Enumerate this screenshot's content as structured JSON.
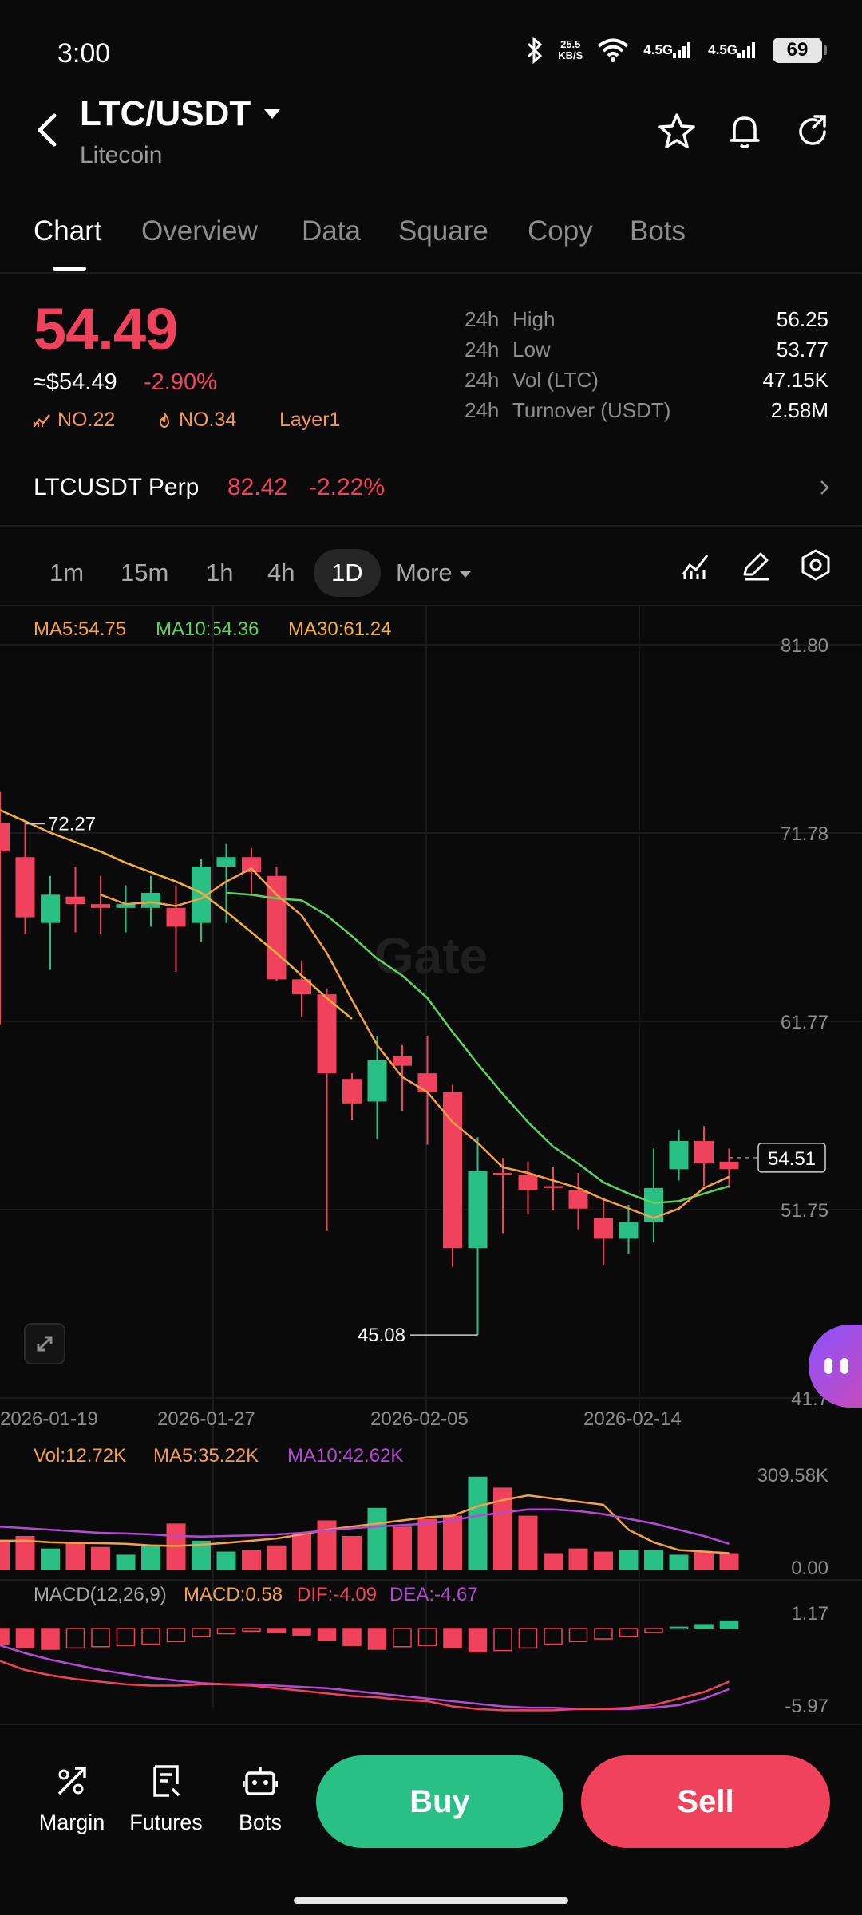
{
  "status": {
    "time": "3:00",
    "net_speed_top": "25.5",
    "net_speed_bottom": "KB/S",
    "net1": "4.5G",
    "net2": "4.5G",
    "battery": "69"
  },
  "header": {
    "pair": "LTC/USDT",
    "name": "Litecoin"
  },
  "tabs": [
    "Chart",
    "Overview",
    "Data",
    "Square",
    "Copy",
    "Bots"
  ],
  "price": {
    "last": "54.49",
    "usd": "≈$54.49",
    "change": "-2.90%",
    "rank1": "NO.22",
    "rank2": "NO.34",
    "category": "Layer1"
  },
  "stats": [
    {
      "period": "24h",
      "label": "High",
      "value": "56.25"
    },
    {
      "period": "24h",
      "label": "Low",
      "value": "53.77"
    },
    {
      "period": "24h",
      "label": "Vol (LTC)",
      "value": "47.15K"
    },
    {
      "period": "24h",
      "label": "Turnover (USDT)",
      "value": "2.58M"
    }
  ],
  "perp": {
    "name": "LTCUSDT Perp",
    "price": "82.42",
    "change": "-2.22%"
  },
  "timeframes": [
    "1m",
    "15m",
    "1h",
    "4h",
    "1D",
    "More"
  ],
  "ma_legend": {
    "ma5": "MA5:54.75",
    "ma10": "MA10:54.36",
    "ma30": "MA30:61.24"
  },
  "colors": {
    "up": "#29c086",
    "down": "#f0425c",
    "ma5": "#f5a14a",
    "ma10": "#5dd45d",
    "ma30": "#f5b23a",
    "vol_ma10": "#b54ad6",
    "dif": "#f0425c",
    "dea": "#b54ad6"
  },
  "watermark": "Gate",
  "chart_data": {
    "type": "candlestick",
    "y_axis_labels": [
      "81.80",
      "71.78",
      "61.77",
      "51.75",
      "41.7"
    ],
    "ylim": [
      41.73,
      81.8
    ],
    "x_axis_labels": [
      "2026-01-19",
      "2026-01-27",
      "2026-02-05",
      "2026-02-14"
    ],
    "current_price_label": "54.51",
    "max_marker": "72.27",
    "min_marker": "45.08",
    "candles": [
      {
        "o": 72.3,
        "h": 74.0,
        "l": 61.6,
        "c": 70.8
      },
      {
        "o": 70.5,
        "h": 72.27,
        "l": 66.4,
        "c": 67.3
      },
      {
        "o": 67.0,
        "h": 69.5,
        "l": 64.5,
        "c": 68.5
      },
      {
        "o": 68.4,
        "h": 70.0,
        "l": 66.5,
        "c": 68.0
      },
      {
        "o": 68.0,
        "h": 69.5,
        "l": 66.4,
        "c": 67.8
      },
      {
        "o": 67.8,
        "h": 69.0,
        "l": 66.5,
        "c": 68.0
      },
      {
        "o": 67.8,
        "h": 69.5,
        "l": 66.8,
        "c": 68.6
      },
      {
        "o": 67.8,
        "h": 69.0,
        "l": 64.4,
        "c": 66.8
      },
      {
        "o": 67.0,
        "h": 70.4,
        "l": 66.0,
        "c": 70.0
      },
      {
        "o": 70.0,
        "h": 71.2,
        "l": 67.0,
        "c": 70.5
      },
      {
        "o": 70.5,
        "h": 71.0,
        "l": 68.5,
        "c": 69.7
      },
      {
        "o": 69.5,
        "h": 70.0,
        "l": 63.9,
        "c": 64.0
      },
      {
        "o": 64.0,
        "h": 65.0,
        "l": 62.0,
        "c": 63.2
      },
      {
        "o": 63.2,
        "h": 63.5,
        "l": 50.6,
        "c": 59.0
      },
      {
        "o": 58.7,
        "h": 59.0,
        "l": 56.5,
        "c": 57.4
      },
      {
        "o": 57.5,
        "h": 61.0,
        "l": 55.5,
        "c": 59.7
      },
      {
        "o": 59.9,
        "h": 60.5,
        "l": 57.0,
        "c": 59.4
      },
      {
        "o": 59.0,
        "h": 61.0,
        "l": 55.2,
        "c": 58.0
      },
      {
        "o": 58.0,
        "h": 58.4,
        "l": 48.7,
        "c": 49.7
      },
      {
        "o": 49.7,
        "h": 55.6,
        "l": 45.08,
        "c": 53.8
      },
      {
        "o": 53.7,
        "h": 54.5,
        "l": 50.5,
        "c": 53.6
      },
      {
        "o": 53.6,
        "h": 54.3,
        "l": 51.5,
        "c": 52.8
      },
      {
        "o": 53.0,
        "h": 54.0,
        "l": 51.7,
        "c": 52.9
      },
      {
        "o": 52.8,
        "h": 53.7,
        "l": 50.7,
        "c": 51.8
      },
      {
        "o": 51.3,
        "h": 52.3,
        "l": 48.8,
        "c": 50.2
      },
      {
        "o": 50.2,
        "h": 52.0,
        "l": 49.4,
        "c": 51.1
      },
      {
        "o": 51.1,
        "h": 55.0,
        "l": 50.0,
        "c": 52.9
      },
      {
        "o": 53.9,
        "h": 56.0,
        "l": 53.3,
        "c": 55.4
      },
      {
        "o": 55.4,
        "h": 56.2,
        "l": 53.0,
        "c": 54.2
      },
      {
        "o": 54.3,
        "h": 55.0,
        "l": 52.9,
        "c": 53.9
      }
    ],
    "ma5": [
      null,
      null,
      null,
      null,
      68.5,
      68.0,
      68.1,
      67.9,
      68.3,
      69.2,
      69.9,
      68.5,
      67.4,
      65.4,
      62.9,
      60.5,
      58.8,
      58.0,
      56.4,
      55.3,
      54.0,
      53.7,
      53.3,
      52.9,
      52.3,
      51.8,
      51.3,
      51.8,
      52.9,
      53.5
    ],
    "ma10": [
      null,
      null,
      null,
      null,
      null,
      null,
      null,
      null,
      null,
      68.6,
      68.5,
      68.3,
      68.2,
      67.4,
      66.3,
      65.1,
      64.2,
      63.0,
      61.2,
      59.5,
      57.9,
      56.4,
      55.1,
      54.2,
      53.2,
      52.6,
      52.1,
      52.2,
      52.6,
      53.0
    ],
    "ma30_visible": [
      73.0,
      72.4,
      71.8,
      71.3,
      70.8,
      70.2,
      69.7,
      69.2,
      68.6,
      67.6,
      66.5,
      65.4,
      64.2,
      63.0,
      61.9
    ],
    "volume": {
      "legend": {
        "vol": "Vol:12.72K",
        "ma5": "MA5:35.22K",
        "ma10": "MA10:42.62K"
      },
      "max_label": "309.58K",
      "zero_label": "0.00",
      "values": [
        95,
        110,
        70,
        90,
        75,
        50,
        80,
        150,
        95,
        60,
        65,
        80,
        120,
        160,
        110,
        200,
        140,
        165,
        175,
        300,
        265,
        175,
        55,
        70,
        60,
        65,
        65,
        50,
        60,
        55
      ],
      "ma5": [
        95,
        95,
        90,
        88,
        87,
        85,
        80,
        78,
        82,
        88,
        95,
        102,
        115,
        130,
        140,
        150,
        160,
        170,
        175,
        205,
        225,
        240,
        230,
        220,
        210,
        130,
        90,
        65,
        60,
        55
      ],
      "ma10": [
        140,
        135,
        130,
        125,
        120,
        118,
        115,
        110,
        108,
        110,
        112,
        115,
        120,
        128,
        135,
        140,
        145,
        150,
        160,
        175,
        185,
        195,
        195,
        190,
        180,
        165,
        150,
        130,
        110,
        85
      ]
    },
    "macd": {
      "legend": {
        "title": "MACD(12,26,9)",
        "macd": "MACD:0.58",
        "dif": "DIF:-4.09",
        "dea": "DEA:-4.67"
      },
      "max_label": "1.17",
      "min_label": "-5.97",
      "hist": [
        -1.2,
        -1.5,
        -1.6,
        -1.5,
        -1.4,
        -1.3,
        -1.2,
        -1.0,
        -0.6,
        -0.4,
        -0.2,
        -0.3,
        -0.5,
        -0.9,
        -1.3,
        -1.6,
        -1.4,
        -1.3,
        -1.5,
        -1.8,
        -1.7,
        -1.5,
        -1.2,
        -1.0,
        -0.8,
        -0.6,
        -0.3,
        0.1,
        0.3,
        0.58
      ],
      "dif": [
        -2.5,
        -3.2,
        -3.6,
        -3.9,
        -4.1,
        -4.3,
        -4.4,
        -4.4,
        -4.3,
        -4.3,
        -4.4,
        -4.6,
        -4.8,
        -5.0,
        -5.2,
        -5.3,
        -5.5,
        -5.6,
        -6.0,
        -6.2,
        -6.3,
        -6.3,
        -6.3,
        -6.2,
        -6.2,
        -6.1,
        -5.9,
        -5.4,
        -4.9,
        -4.09
      ],
      "dea": [
        -1.3,
        -1.9,
        -2.4,
        -2.8,
        -3.2,
        -3.5,
        -3.8,
        -4.0,
        -4.2,
        -4.3,
        -4.3,
        -4.4,
        -4.5,
        -4.6,
        -4.8,
        -5.0,
        -5.2,
        -5.4,
        -5.6,
        -5.8,
        -6.0,
        -6.1,
        -6.1,
        -6.2,
        -6.2,
        -6.2,
        -6.1,
        -5.9,
        -5.4,
        -4.67
      ]
    }
  },
  "bottom": {
    "margin": "Margin",
    "futures": "Futures",
    "bots": "Bots",
    "buy": "Buy",
    "sell": "Sell"
  }
}
